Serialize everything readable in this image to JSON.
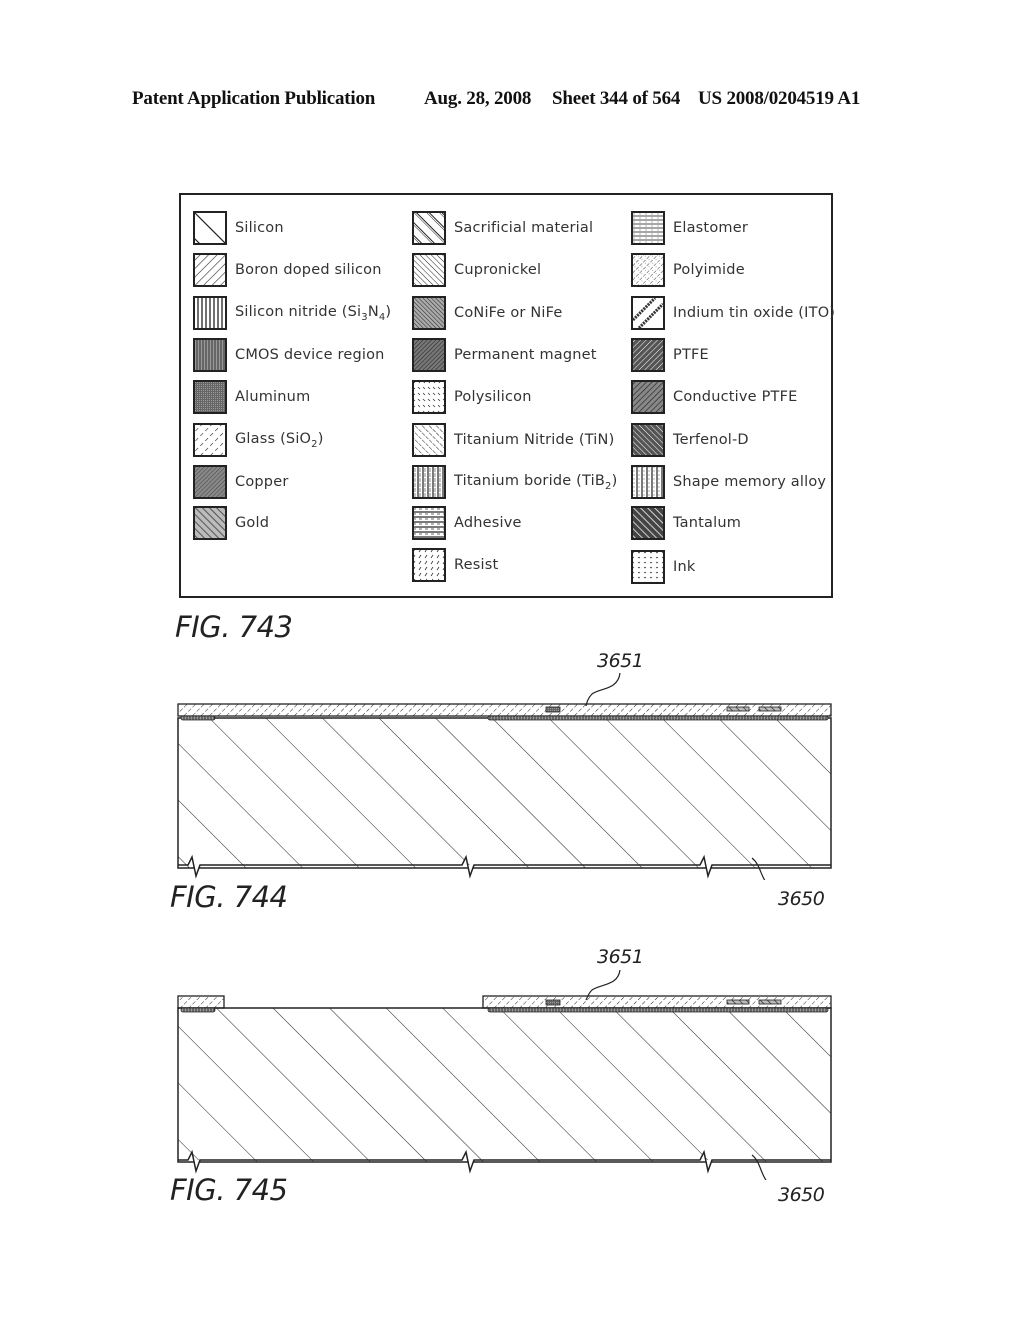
{
  "header": {
    "publication": "Patent Application Publication",
    "date": "Aug. 28, 2008",
    "sheet": "Sheet 344 of 564",
    "patent_number": "US 2008/0204519 A1"
  },
  "legend": {
    "columns": [
      [
        {
          "label": "Silicon",
          "pattern": "silicon"
        },
        {
          "label": "Boron doped silicon",
          "pattern": "boron"
        },
        {
          "label": "Silicon nitride (Si",
          "sub1": "3",
          "mid": "N",
          "sub2": "4",
          "tail": ")",
          "pattern": "nitride"
        },
        {
          "label": "CMOS device region",
          "pattern": "cmos"
        },
        {
          "label": "Aluminum",
          "pattern": "aluminum"
        },
        {
          "label": "Glass (SiO",
          "sub1": "2",
          "tail": ")",
          "pattern": "glass"
        },
        {
          "label": "Copper",
          "pattern": "copper"
        },
        {
          "label": "Gold",
          "pattern": "gold"
        }
      ],
      [
        {
          "label": "Sacrificial material",
          "pattern": "sacrificial"
        },
        {
          "label": "Cupronickel",
          "pattern": "cupronickel"
        },
        {
          "label": "CoNiFe or NiFe",
          "pattern": "conife"
        },
        {
          "label": "Permanent magnet",
          "pattern": "magnet"
        },
        {
          "label": "Polysilicon",
          "pattern": "polysilicon"
        },
        {
          "label": "Titanium Nitride (TiN)",
          "pattern": "tin"
        },
        {
          "label": "Titanium boride (TiB",
          "sub1": "2",
          "tail": ")",
          "pattern": "tib2"
        },
        {
          "label": "Adhesive",
          "pattern": "adhesive"
        },
        {
          "label": "Resist",
          "pattern": "resist"
        }
      ],
      [
        {
          "label": "Elastomer",
          "pattern": "elastomer"
        },
        {
          "label": "Polyimide",
          "pattern": "polyimide"
        },
        {
          "label": "Indium tin oxide (ITO)",
          "pattern": "ito"
        },
        {
          "label": "PTFE",
          "pattern": "ptfe"
        },
        {
          "label": "Conductive PTFE",
          "pattern": "cptfe"
        },
        {
          "label": "Terfenol-D",
          "pattern": "terfenol"
        },
        {
          "label": "Shape memory alloy",
          "pattern": "sma"
        },
        {
          "label": "Tantalum",
          "pattern": "tantalum"
        },
        {
          "label": "Ink",
          "pattern": "ink"
        }
      ]
    ]
  },
  "figures": [
    {
      "label": "FIG. 743"
    },
    {
      "label": "FIG. 744",
      "refs": {
        "layer": "3651",
        "substrate": "3650"
      }
    },
    {
      "label": "FIG. 745",
      "refs": {
        "layer": "3651",
        "substrate": "3650"
      }
    }
  ]
}
